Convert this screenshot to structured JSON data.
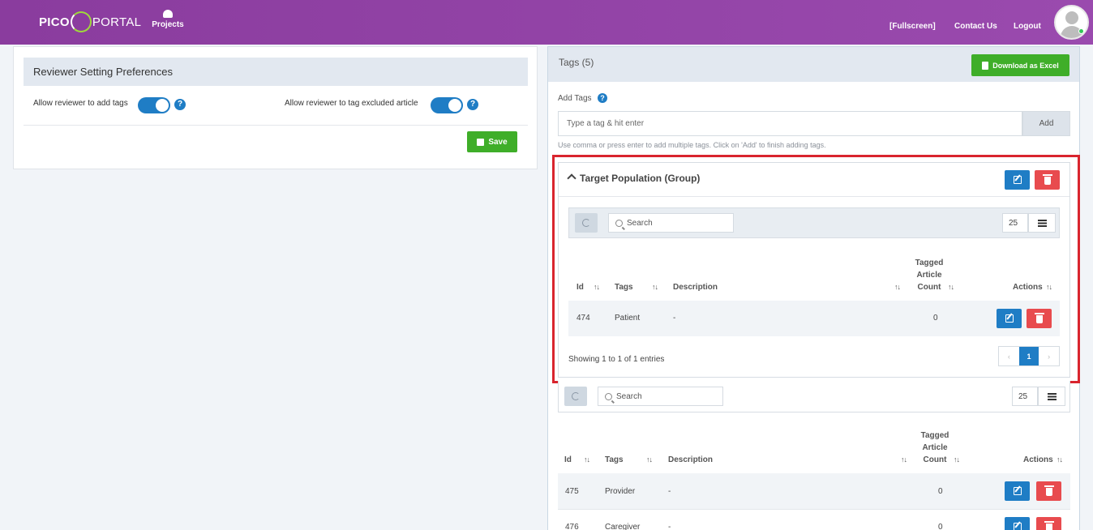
{
  "app": {
    "logo_pico": "PICO",
    "logo_portal": "PORTAL"
  },
  "nav": {
    "projects": "Projects",
    "fullscreen": "[Fullscreen]",
    "contact": "Contact Us",
    "logout": "Logout"
  },
  "preferences": {
    "title": "Reviewer Setting Preferences",
    "allow_add_tags_label": "Allow reviewer to add tags",
    "allow_add_tags": true,
    "allow_tag_excluded_label": "Allow reviewer to tag excluded article",
    "allow_tag_excluded": true,
    "save_label": "Save"
  },
  "tags": {
    "title": "Tags (5)",
    "download_label": "Download as Excel",
    "add_label": "Add Tags",
    "input_placeholder": "Type a tag & hit enter",
    "add_button": "Add",
    "hint": "Use comma or press enter to add multiple tags. Click on 'Add' to finish adding tags."
  },
  "group": {
    "title": "Target Population (Group)",
    "search_placeholder": "Search",
    "page_size": "25",
    "columns": {
      "id": "Id",
      "tags": "Tags",
      "description": "Description",
      "count_1": "Tagged",
      "count_2": "Article",
      "count_3": "Count",
      "actions": "Actions"
    },
    "rows": [
      {
        "id": "474",
        "tag": "Patient",
        "description": "-",
        "count": "0"
      }
    ],
    "showing": "Showing 1 to 1 of 1 entries",
    "prev": "‹",
    "current_page": "1",
    "next": "›"
  },
  "ungrouped": {
    "search_placeholder": "Search",
    "page_size": "25",
    "columns": {
      "id": "Id",
      "tags": "Tags",
      "description": "Description",
      "count_1": "Tagged",
      "count_2": "Article",
      "count_3": "Count",
      "actions": "Actions"
    },
    "rows": [
      {
        "id": "475",
        "tag": "Provider",
        "description": "-",
        "count": "0"
      },
      {
        "id": "476",
        "tag": "Caregiver",
        "description": "-",
        "count": "0"
      }
    ]
  },
  "colors": {
    "header_purple": "#8a3c9e",
    "primary_blue": "#1f7dc5",
    "success_green": "#3fae29",
    "danger_red": "#e84b4e",
    "highlight_red": "#d9252e"
  },
  "icons": {
    "refresh": "refresh-icon",
    "search": "search-icon",
    "columns": "columns-icon",
    "edit": "edit-icon",
    "delete": "trash-icon",
    "help": "question-icon"
  }
}
